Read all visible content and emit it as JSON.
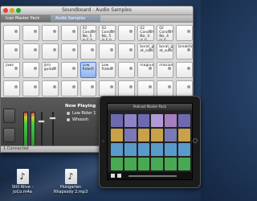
{
  "window": {
    "title": "Soundboard - Audio Samples",
    "tabs": [
      {
        "label": "Ican Master Pack",
        "active": false
      },
      {
        "label": "Audio Samples",
        "active": true
      }
    ]
  },
  "pads": [
    {
      "label": ""
    },
    {
      "label": ""
    },
    {
      "label": ""
    },
    {
      "label": ""
    },
    {
      "label": "02 Concerto No. 5 in E b"
    },
    {
      "label": "02 Concerto No. 5 in E b"
    },
    {
      "label": ""
    },
    {
      "label": "02 Concerto No. 4 in G"
    },
    {
      "label": "02 Concerto No. 4 in G"
    },
    {
      "label": ""
    },
    {
      "label": ""
    },
    {
      "label": ""
    },
    {
      "label": ""
    },
    {
      "label": ""
    },
    {
      "label": ""
    },
    {
      "label": ""
    },
    {
      "label": ""
    },
    {
      "label": "borat_gre at_success"
    },
    {
      "label": "borat_gre at_success"
    },
    {
      "label": "breakfast_in_america"
    },
    {
      "label": "jaws"
    },
    {
      "label": ""
    },
    {
      "label": "jimi guitar"
    },
    {
      "label": ""
    },
    {
      "label": "Low Rider"
    },
    {
      "label": "Low Rider"
    },
    {
      "label": ""
    },
    {
      "label": "magnum"
    },
    {
      "label": "mission_impossible"
    },
    {
      "label": ""
    },
    {
      "label": ""
    },
    {
      "label": ""
    },
    {
      "label": ""
    },
    {
      "label": ""
    },
    {
      "label": ""
    },
    {
      "label": ""
    },
    {
      "label": ""
    },
    {
      "label": ""
    },
    {
      "label": ""
    },
    {
      "label": ""
    }
  ],
  "selected_pad_index": 24,
  "now_playing": {
    "title": "Now Playing",
    "items": [
      "Low Rider 1",
      "Whoosh"
    ]
  },
  "status": "1 Connected",
  "ipad": {
    "title": "Podcast Master Pack",
    "pad_colors": [
      "#6e6ab0",
      "#8d84c8",
      "#6e6ab0",
      "#b29ad6",
      "#a57fbf",
      "#6e6ab0",
      "#c7a24a",
      "#7a78b6",
      "#c7a24a",
      "#c7a24a",
      "#7a78b6",
      "#c7a24a",
      "#5a9acb",
      "#5a9acb",
      "#5a9acb",
      "#5a9acb",
      "#5a9acb",
      "#5a9acb",
      "#49a852",
      "#49a852",
      "#49a852",
      "#49a852",
      "#49a852",
      "#49a852"
    ]
  },
  "desktop_files": [
    {
      "name": "Still Alive - JoCo.m4a",
      "icon": "music-note-icon"
    },
    {
      "name": "Hungarian Rhapsody 2.mp3",
      "icon": "music-note-icon"
    }
  ]
}
